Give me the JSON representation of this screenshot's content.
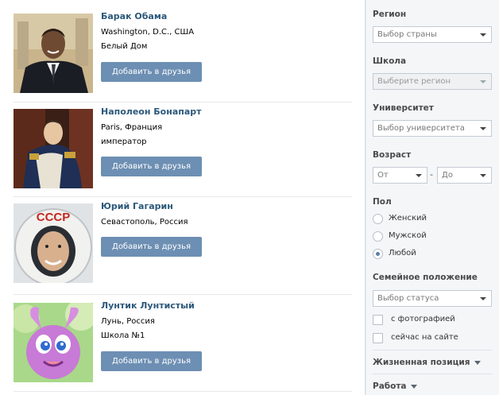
{
  "people": [
    {
      "name": "Барак Обама",
      "line1": "Washington, D.C., США",
      "line2": "Белый Дом",
      "button": "Добавить в друзья",
      "photo_icon": "avatar-obama"
    },
    {
      "name": "Наполеон Бонапарт",
      "line1": "Paris, Франция",
      "line2": "император",
      "button": "Добавить в друзья",
      "photo_icon": "avatar-napoleon"
    },
    {
      "name": "Юрий Гагарин",
      "line1": "Севастополь, Россия",
      "button": "Добавить в друзья",
      "photo_icon": "avatar-gagarin",
      "helmet_text": "СССР"
    },
    {
      "name": "Лунтик Лунтистый",
      "line1": "Лунь, Россия",
      "line2": "Школа №1",
      "button": "Добавить в друзья",
      "photo_icon": "avatar-luntik"
    }
  ],
  "filters": {
    "region": {
      "label": "Регион",
      "placeholder": "Выбор страны"
    },
    "school": {
      "label": "Школа",
      "placeholder": "Выберите регион"
    },
    "university": {
      "label": "Университет",
      "placeholder": "Выбор университета"
    },
    "age": {
      "label": "Возраст",
      "from": "От",
      "dash": "-",
      "to": "До"
    },
    "sex": {
      "label": "Пол",
      "options": [
        "Женский",
        "Мужской",
        "Любой"
      ],
      "selected": "Любой"
    },
    "marital": {
      "label": "Семейное положение",
      "placeholder": "Выбор статуса"
    },
    "with_photo": "с фотографией",
    "online_now": "сейчас на сайте",
    "life_position": "Жизненная позиция",
    "work": "Работа"
  },
  "colors": {
    "link": "#2b587a",
    "button": "#6d8fb3",
    "sidebar_bg": "#f5f6f8"
  }
}
